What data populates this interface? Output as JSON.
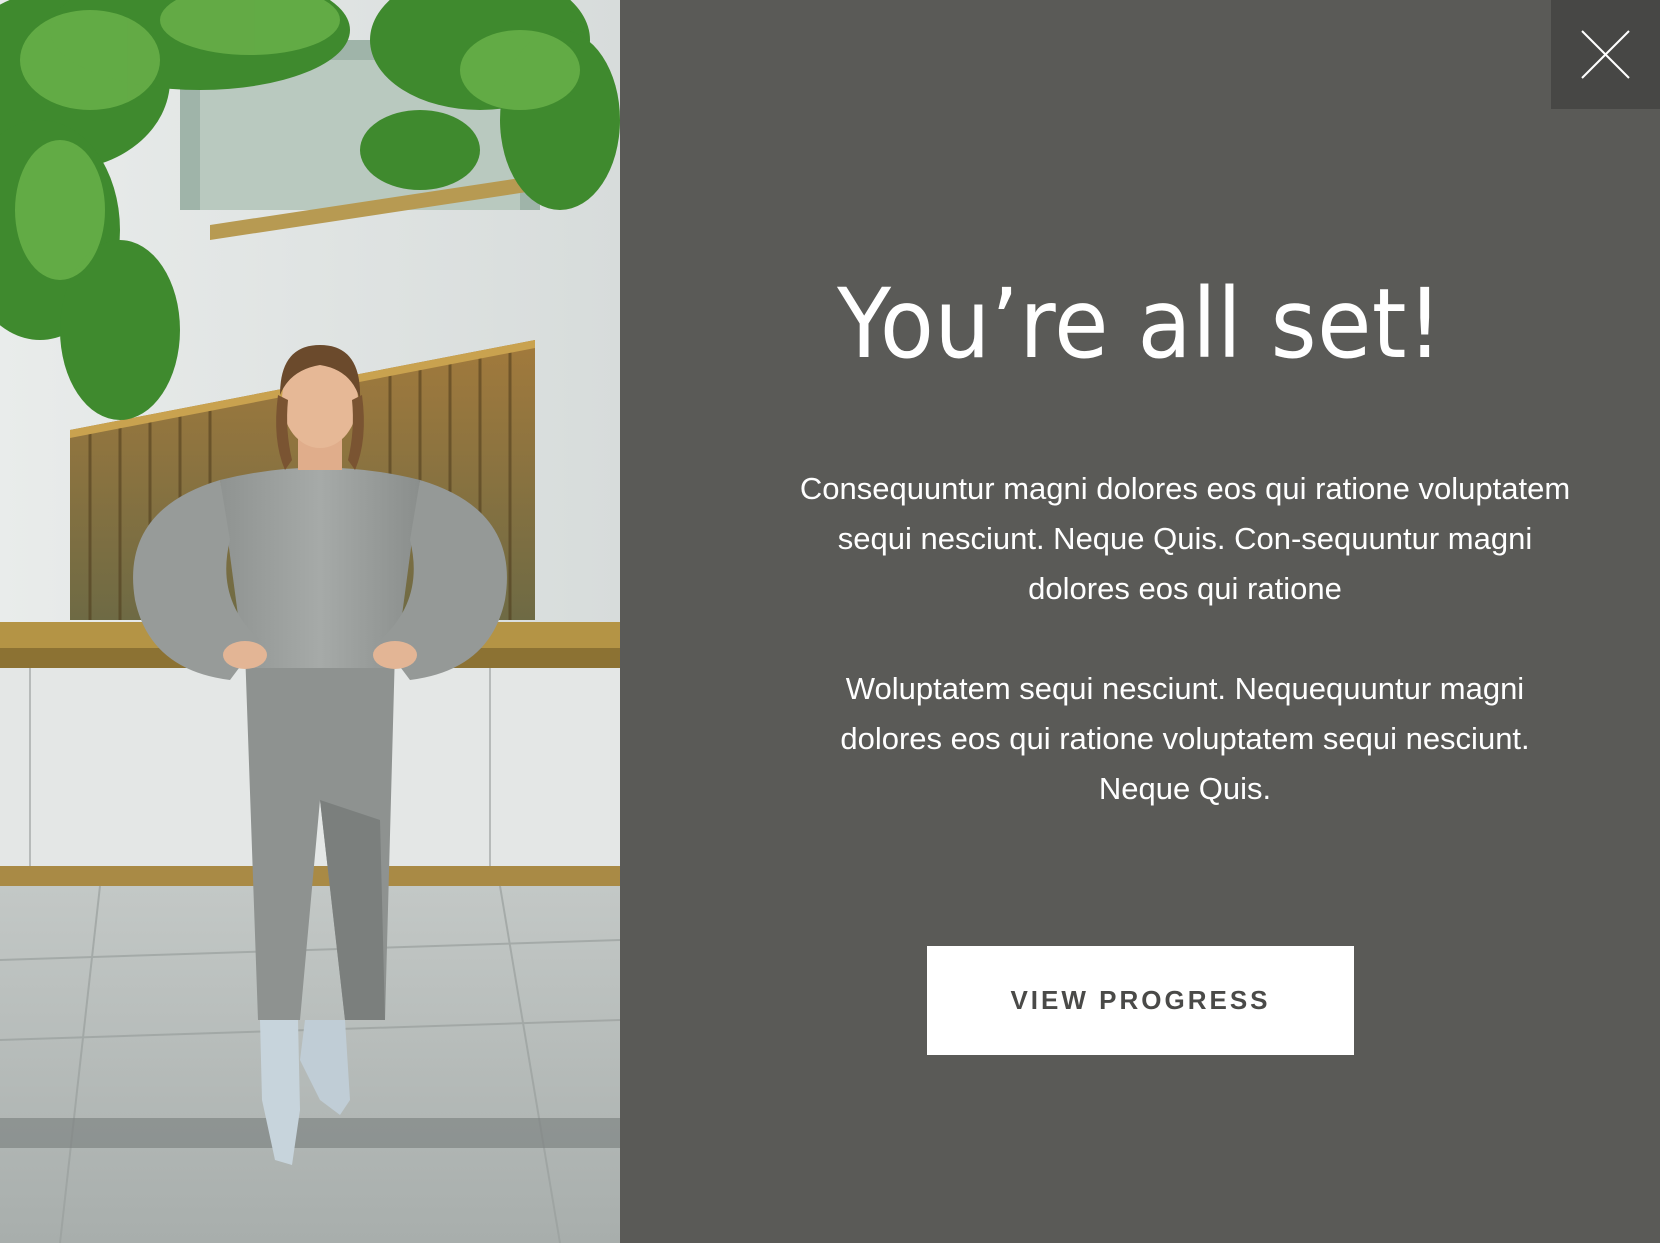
{
  "modal": {
    "title": "You’re all set!",
    "paragraphs": [
      "Consequuntur magni dolores eos qui ratione voluptatem sequi nesciunt. Neque Quis. Con-sequuntur magni dolores eos qui ratione",
      "Woluptatem sequi nesciunt. Nequequuntur magni dolores eos qui ratione voluptatem sequi nesciunt. Neque Quis."
    ],
    "cta_label": "VIEW PROGRESS",
    "close_icon": "close-icon",
    "photo_subject": "woman-in-grey-outfit-photo"
  },
  "colors": {
    "panel_background": "#5a5a57",
    "close_button_background": "#474745",
    "text": "#ffffff",
    "button_background": "#ffffff",
    "button_text": "#4a4a48"
  }
}
